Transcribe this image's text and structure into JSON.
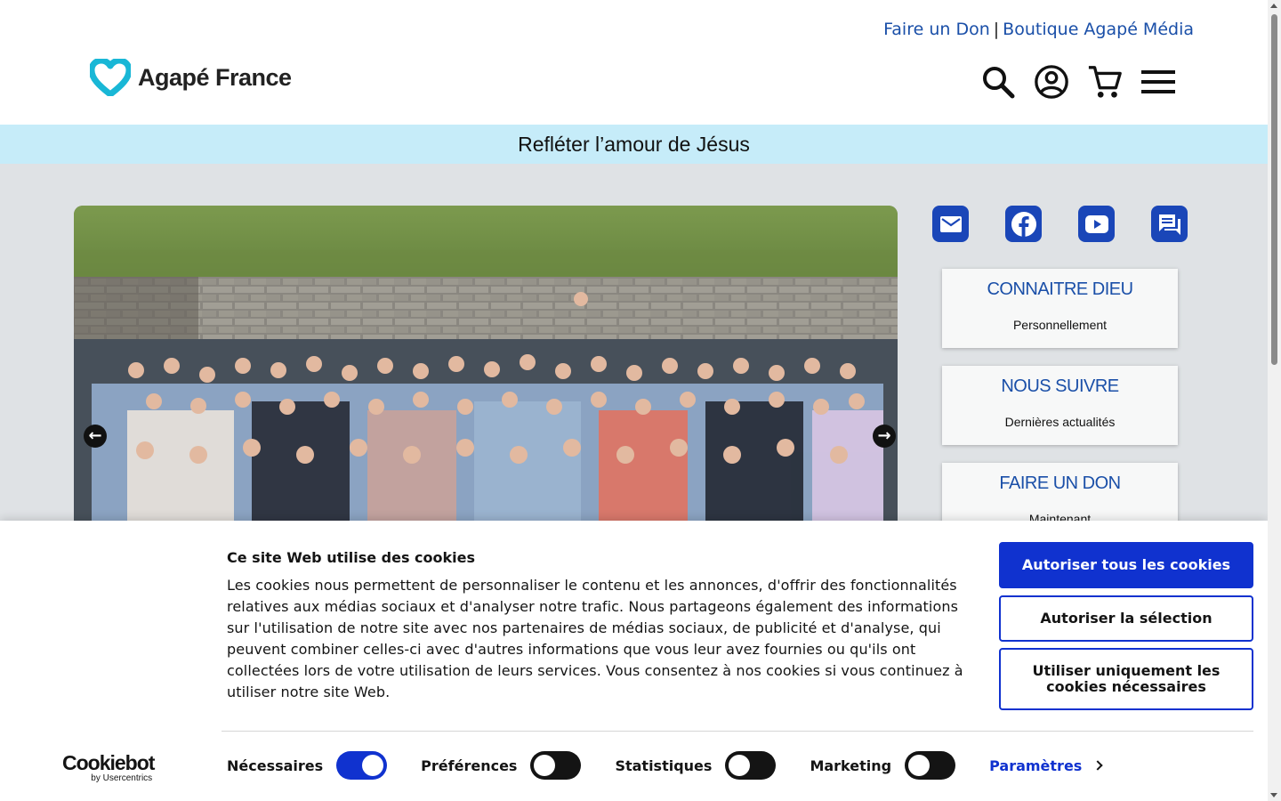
{
  "header": {
    "top_links": [
      {
        "label": "Faire un Don"
      },
      {
        "label": "Boutique Agapé Média"
      }
    ],
    "separator": "|",
    "logo_text": "Agapé France",
    "icons": [
      "search-icon",
      "account-icon",
      "cart-icon",
      "menu-icon"
    ]
  },
  "tagline": "Refléter l’amour de Jésus",
  "carousel": {
    "prev_label": "←",
    "next_label": "→"
  },
  "social": [
    "mail-icon",
    "facebook-icon",
    "youtube-icon",
    "chat-icon"
  ],
  "cards": [
    {
      "title": "CONNAITRE DIEU",
      "subtitle": "Personnellement"
    },
    {
      "title": "NOUS SUIVRE",
      "subtitle": "Dernières actualités"
    },
    {
      "title": "FAIRE UN DON",
      "subtitle": "Maintenant"
    }
  ],
  "cookie": {
    "title": "Ce site Web utilise des cookies",
    "text": "Les cookies nous permettent de personnaliser le contenu et les annonces, d'offrir des fonctionnalités relatives aux médias sociaux et d'analyser notre trafic. Nous partageons également des informations sur l'utilisation de notre site avec nos partenaires de médias sociaux, de publicité et d'analyse, qui peuvent combiner celles-ci avec d'autres informations que vous leur avez fournies ou qu'ils ont collectées lors de votre utilisation de leurs services. Vous consentez à nos cookies si vous continuez à utiliser notre site Web.",
    "btn_allow_all": "Autoriser tous les cookies",
    "btn_allow_selection": "Autoriser la sélection",
    "btn_necessary_only": "Utiliser uniquement les cookies nécessaires",
    "brand_name": "Cookiebot",
    "brand_sub": "by Usercentrics",
    "toggles": [
      {
        "label": "Nécessaires",
        "on": true
      },
      {
        "label": "Préférences",
        "on": false
      },
      {
        "label": "Statistiques",
        "on": false
      },
      {
        "label": "Marketing",
        "on": false
      }
    ],
    "settings_label": "Paramètres"
  },
  "colors": {
    "link_blue": "#1a4fa8",
    "tagline_bg": "#c6ecf9",
    "main_bg": "#dfe2e5",
    "social_blue": "#1a46b8",
    "cookie_blue": "#1032cf",
    "logo_cyan": "#19b7d6"
  }
}
